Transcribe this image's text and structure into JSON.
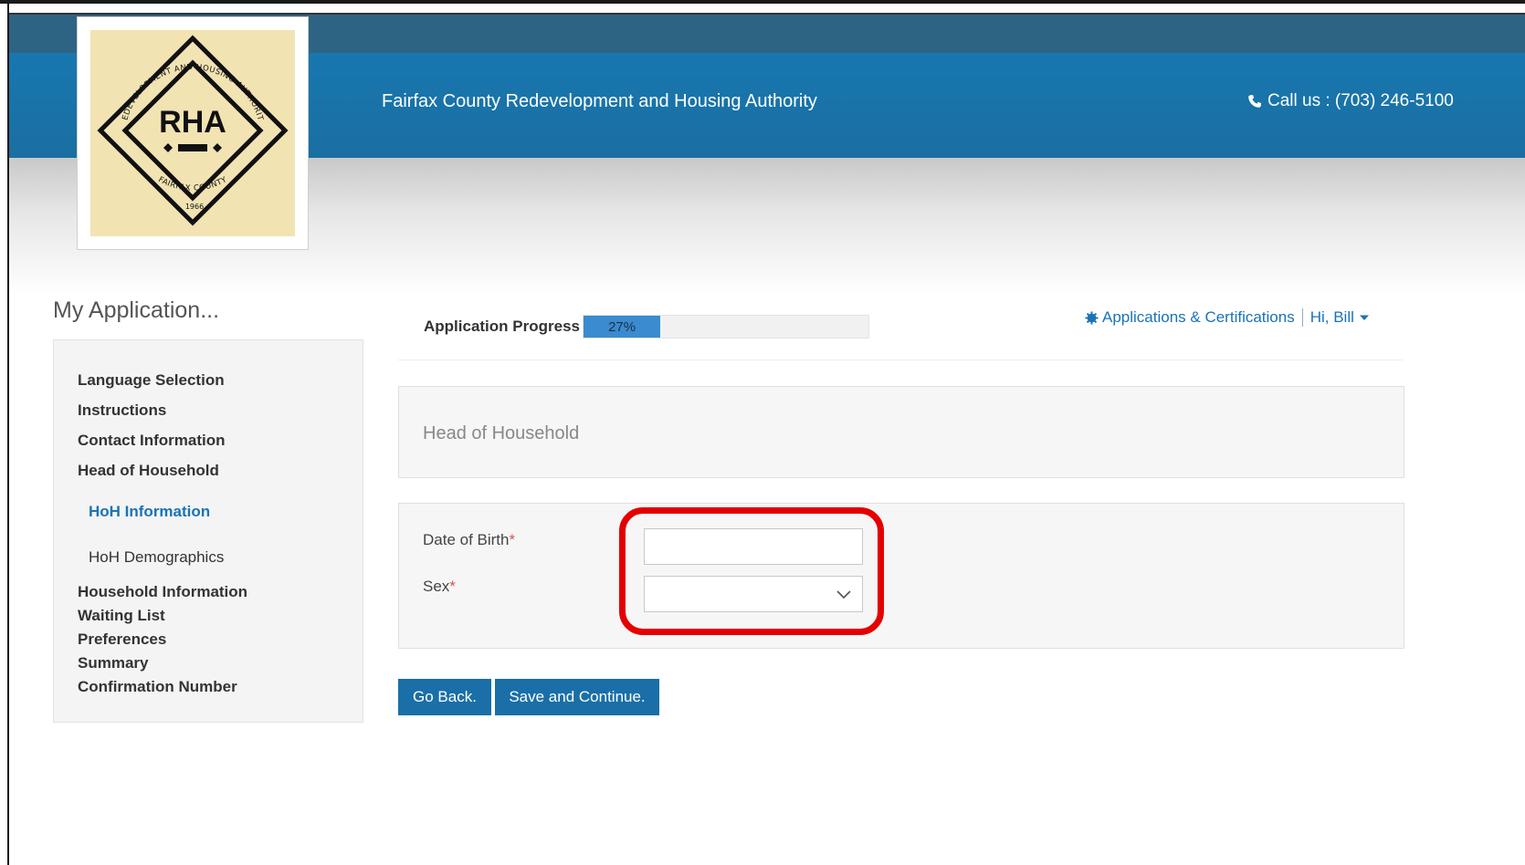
{
  "header": {
    "org_name": "Fairfax County Redevelopment and Housing Authority",
    "phone_label": "Call us : (703) 246-5100",
    "logo": {
      "center_text": "RHA",
      "ring_text_top": "REDEVELOPMENT AND HOUSING AUTHORITY",
      "ring_text_bottom": "FAIRFAX COUNTY",
      "year": "1966"
    }
  },
  "sidebar": {
    "title": "My Application...",
    "items": [
      {
        "label": "Language Selection"
      },
      {
        "label": "Instructions"
      },
      {
        "label": "Contact Information"
      },
      {
        "label": "Head of Household"
      },
      {
        "label": "HoH Information",
        "sub": true,
        "active": true
      },
      {
        "label": "HoH Demographics",
        "sub": true
      },
      {
        "label": "Household Information"
      },
      {
        "label": "Waiting List"
      },
      {
        "label": "Preferences"
      },
      {
        "label": "Summary"
      },
      {
        "label": "Confirmation Number"
      }
    ]
  },
  "progress": {
    "label": "Application Progress",
    "percent_text": "27%",
    "value": 27
  },
  "top_links": {
    "applications": "Applications & Certifications",
    "user": "Hi, Bill"
  },
  "section": {
    "title": "Head of Household"
  },
  "form": {
    "dob_label": "Date of Birth",
    "dob_value": "",
    "sex_label": "Sex",
    "sex_value": "",
    "required_mark": "*"
  },
  "buttons": {
    "back": "Go Back.",
    "save": "Save and Continue."
  },
  "colors": {
    "header_top": "#2d6483",
    "header_main": "#1877b0",
    "link": "#1a73b5",
    "button": "#1a6fa8",
    "progress_fill": "#3a8bd0",
    "highlight": "#e40000",
    "logo_bg": "#f2e3b3"
  }
}
